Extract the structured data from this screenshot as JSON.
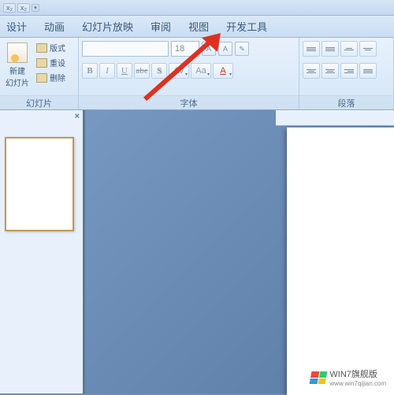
{
  "titlebar": {
    "sup": "x₂",
    "sub": "x₂"
  },
  "menubar": {
    "items": [
      "设计",
      "动画",
      "幻灯片放映",
      "审阅",
      "视图",
      "开发工具"
    ]
  },
  "ribbon": {
    "slides": {
      "label": "幻灯片",
      "new_line1": "新建",
      "new_line2": "幻灯片",
      "layout": "版式",
      "reset": "重设",
      "delete": "删除"
    },
    "font": {
      "label": "字体",
      "size": "18",
      "bold": "B",
      "italic": "I",
      "underline": "U",
      "strike": "abe",
      "shadow": "S",
      "av": "AV",
      "aa": "Aa",
      "color": "A"
    },
    "para": {
      "label": "段落"
    }
  },
  "watermark": {
    "brand": "WIN7旗舰版",
    "url": "www.win7qijian.com"
  }
}
